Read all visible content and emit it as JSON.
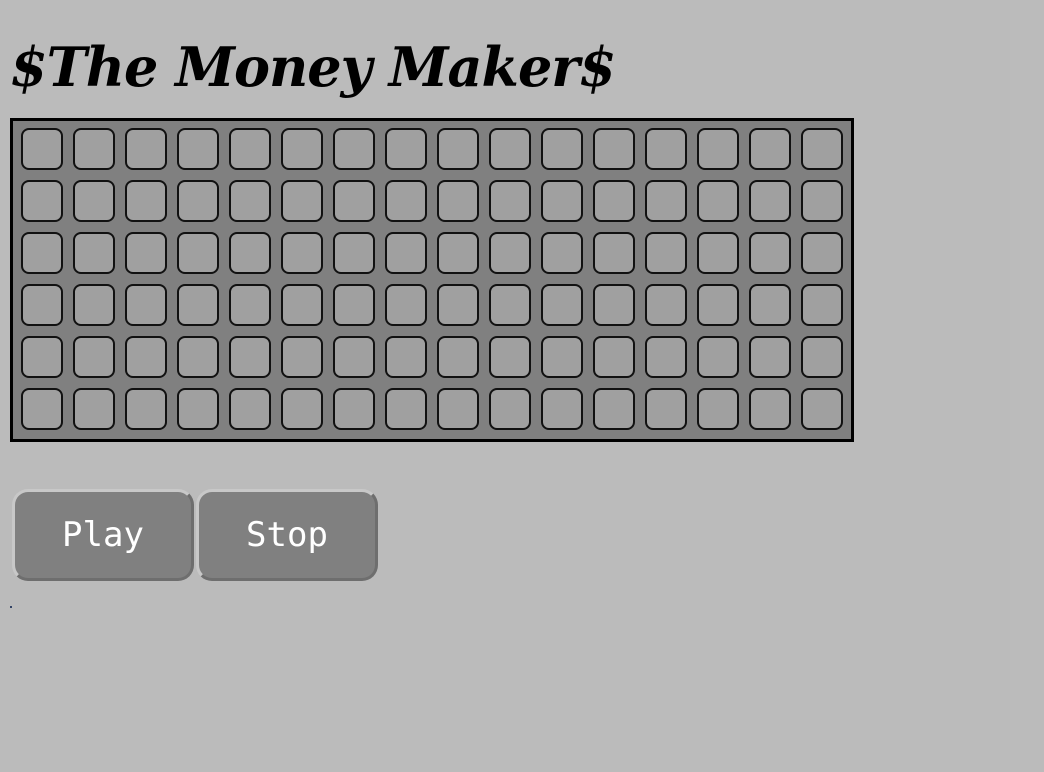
{
  "title": "$The Money Maker$",
  "grid": {
    "rows": 6,
    "cols": 16
  },
  "controls": {
    "play_label": "Play",
    "stop_label": "Stop"
  },
  "colors": {
    "background": "#bbbbbb",
    "board": "#808080",
    "cell": "#a0a0a0",
    "button": "#808080",
    "button_text": "#ffffff"
  }
}
